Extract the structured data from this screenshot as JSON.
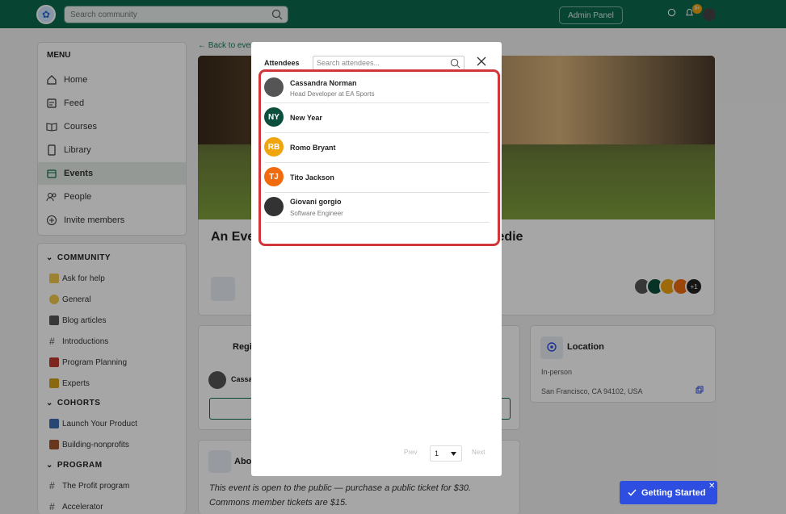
{
  "topbar": {
    "search_placeholder": "Search community",
    "admin_label": "Admin Panel",
    "notif_count": "9+"
  },
  "sidebar": {
    "menu_title": "MENU",
    "items": [
      {
        "label": "Home",
        "icon": "home-icon"
      },
      {
        "label": "Feed",
        "icon": "feed-icon"
      },
      {
        "label": "Courses",
        "icon": "book-icon"
      },
      {
        "label": "Library",
        "icon": "library-icon"
      },
      {
        "label": "Events",
        "icon": "calendar-icon"
      },
      {
        "label": "People",
        "icon": "people-icon"
      },
      {
        "label": "Invite members",
        "icon": "plus-circle-icon"
      }
    ],
    "sections": [
      {
        "title": "COMMUNITY",
        "items": [
          "Ask for help",
          "General",
          "Blog articles",
          "Introductions",
          "Program Planning",
          "Experts"
        ]
      },
      {
        "title": "COHORTS",
        "items": [
          "Launch Your Product",
          "Building-nonprofits"
        ]
      },
      {
        "title": "PROGRAM",
        "items": [
          "The Profit program",
          "Accelerator"
        ]
      }
    ]
  },
  "page": {
    "back_label": "Back to events",
    "event_title": "An Event for the Nervous System with Cat Tweedie",
    "attendee_extra": "+1",
    "registration_label": "Registration",
    "registrant_name": "Cassandra Norman",
    "location_label": "Location",
    "location_type": "In-person",
    "location_address": "San Francisco, CA 94102, USA",
    "about_label": "About",
    "about_text": "This event is open to the public — purchase a public ticket for $30. Commons member tickets are $15."
  },
  "modal": {
    "title": "Attendees",
    "search_placeholder": "Search attendees...",
    "attendees": [
      {
        "name": "Cassandra Norman",
        "subtitle": "Head Developer at EA Sports",
        "initials": "",
        "color": "#555555"
      },
      {
        "name": "New Year",
        "subtitle": "",
        "initials": "NY",
        "color": "#0b4f3c"
      },
      {
        "name": "Romo Bryant",
        "subtitle": "",
        "initials": "RB",
        "color": "#f0a40e"
      },
      {
        "name": "Tito Jackson",
        "subtitle": "",
        "initials": "TJ",
        "color": "#f06a0e"
      },
      {
        "name": "Giovani gorgio",
        "subtitle": "Software Engineer",
        "initials": "",
        "color": "#333333"
      }
    ],
    "pager": {
      "prev": "Prev",
      "page": "1",
      "next": "Next"
    }
  },
  "getting_started": {
    "label": "Getting Started"
  }
}
